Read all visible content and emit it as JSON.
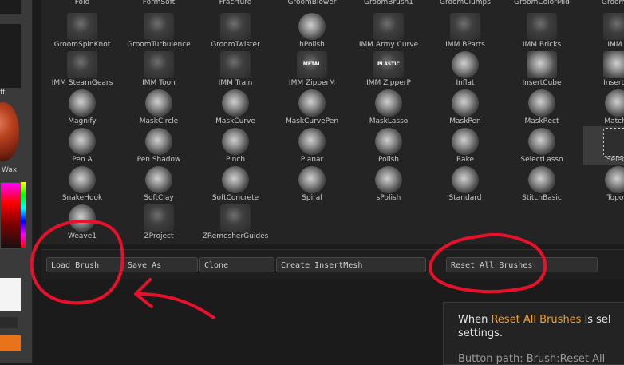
{
  "left_strip": {
    "frag_top": "ff",
    "frag_wax": "Wax"
  },
  "brushes": [
    {
      "label": "Fold",
      "row": 0
    },
    {
      "label": "FormSoft",
      "row": 0
    },
    {
      "label": "Fracrture",
      "row": 0
    },
    {
      "label": "GroomBlower",
      "row": 0
    },
    {
      "label": "GroomBrush1",
      "row": 0
    },
    {
      "label": "GroomClumps",
      "row": 0
    },
    {
      "label": "GroomColorMid",
      "row": 0
    },
    {
      "label": "GroomCo",
      "row": 0
    },
    {
      "label": "GroomSpinKnot",
      "row": 1
    },
    {
      "label": "GroomTurbulence",
      "row": 1
    },
    {
      "label": "GroomTwister",
      "row": 1
    },
    {
      "label": "hPolish",
      "row": 1
    },
    {
      "label": "IMM  Army  Curve",
      "row": 1
    },
    {
      "label": "IMM  BParts",
      "row": 1
    },
    {
      "label": "IMM  Bricks",
      "row": 1
    },
    {
      "label": "IMM  C",
      "row": 1
    },
    {
      "label": "IMM  SteamGears",
      "row": 2
    },
    {
      "label": "IMM  Toon",
      "row": 2
    },
    {
      "label": "IMM  Train",
      "row": 2
    },
    {
      "label": "IMM  ZipperM",
      "row": 2
    },
    {
      "label": "IMM  ZipperP",
      "row": 2
    },
    {
      "label": "Inflat",
      "row": 2
    },
    {
      "label": "InsertCube",
      "row": 2
    },
    {
      "label": "InsertCy",
      "row": 2
    },
    {
      "label": "Magnify",
      "row": 3
    },
    {
      "label": "MaskCircle",
      "row": 3
    },
    {
      "label": "MaskCurve",
      "row": 3
    },
    {
      "label": "MaskCurvePen",
      "row": 3
    },
    {
      "label": "MaskLasso",
      "row": 3
    },
    {
      "label": "MaskPen",
      "row": 3
    },
    {
      "label": "MaskRect",
      "row": 3
    },
    {
      "label": "MatchM",
      "row": 3
    },
    {
      "label": "Pen  A",
      "row": 4
    },
    {
      "label": "Pen  Shadow",
      "row": 4
    },
    {
      "label": "Pinch",
      "row": 4
    },
    {
      "label": "Planar",
      "row": 4
    },
    {
      "label": "Polish",
      "row": 4
    },
    {
      "label": "Rake",
      "row": 4
    },
    {
      "label": "SelectLasso",
      "row": 4
    },
    {
      "label": "Selecti",
      "row": 4
    },
    {
      "label": "SnakeHook",
      "row": 5
    },
    {
      "label": "SoftClay",
      "row": 5
    },
    {
      "label": "SoftConcrete",
      "row": 5
    },
    {
      "label": "Spiral",
      "row": 5
    },
    {
      "label": "sPolish",
      "row": 5
    },
    {
      "label": "Standard",
      "row": 5
    },
    {
      "label": "StitchBasic",
      "row": 5
    },
    {
      "label": "Topolo",
      "row": 5
    },
    {
      "label": "Weave1",
      "row": 6
    },
    {
      "label": "ZProject",
      "row": 6
    },
    {
      "label": "ZRemesherGuides",
      "row": 6
    }
  ],
  "thumb_text": {
    "zipperm": "METAL",
    "zipperp": "PLASTIC"
  },
  "buttons": {
    "load_brush": "Load Brush",
    "save_as": "Save As",
    "clone": "Clone",
    "create_insertmesh": "Create InsertMesh",
    "reset_all_brushes": "Reset All Brushes"
  },
  "info": {
    "when": "When ",
    "highlight": "Reset All Brushes",
    "rest": " is sel",
    "line2": "settings.",
    "path": "Button path: Brush:Reset All"
  },
  "colors": {
    "annotation": "#e8102a",
    "highlight": "#f1a227"
  }
}
